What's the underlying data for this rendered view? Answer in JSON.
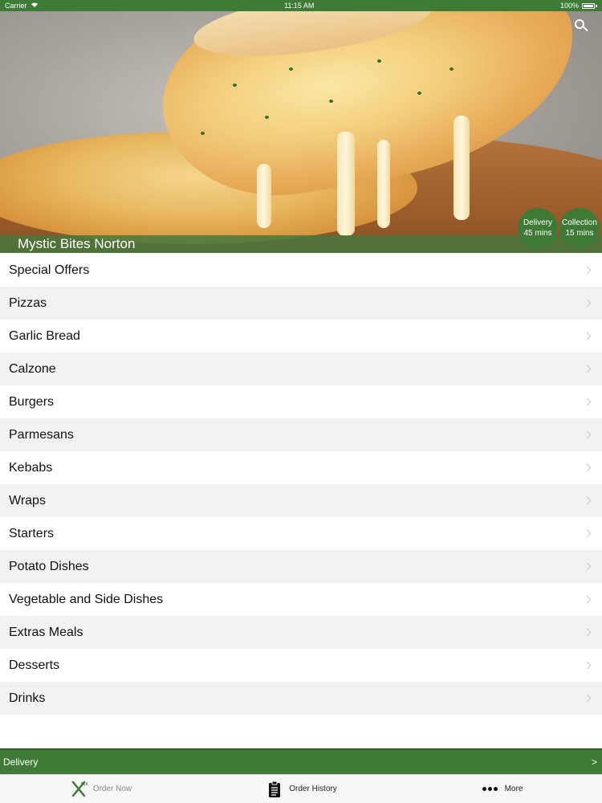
{
  "status_bar": {
    "carrier": "Carrier",
    "time": "11:15 AM",
    "battery": "100%"
  },
  "hero": {
    "title": "Mystic Bites Norton",
    "delivery": {
      "label": "Delivery",
      "time": "45 mins"
    },
    "collection": {
      "label": "Collection",
      "time": "15 mins"
    },
    "search_icon": "search-icon"
  },
  "menu": {
    "items": [
      {
        "label": "Special Offers"
      },
      {
        "label": "Pizzas"
      },
      {
        "label": "Garlic Bread"
      },
      {
        "label": "Calzone"
      },
      {
        "label": "Burgers"
      },
      {
        "label": "Parmesans"
      },
      {
        "label": "Kebabs"
      },
      {
        "label": "Wraps"
      },
      {
        "label": "Starters"
      },
      {
        "label": "Potato Dishes"
      },
      {
        "label": "Vegetable and Side Dishes"
      },
      {
        "label": "Extras Meals"
      },
      {
        "label": "Desserts"
      },
      {
        "label": "Drinks"
      }
    ]
  },
  "delivery_bar": {
    "label": "Delivery",
    "arrow": ">"
  },
  "tab_bar": {
    "tabs": [
      {
        "label": "Order Now",
        "icon": "fork-knife-icon"
      },
      {
        "label": "Order History",
        "icon": "clipboard-icon"
      },
      {
        "label": "More",
        "icon": "more-dots-icon"
      }
    ]
  },
  "colors": {
    "brand_green": "#3f7a37",
    "row_alt": "#f2f2f4"
  }
}
